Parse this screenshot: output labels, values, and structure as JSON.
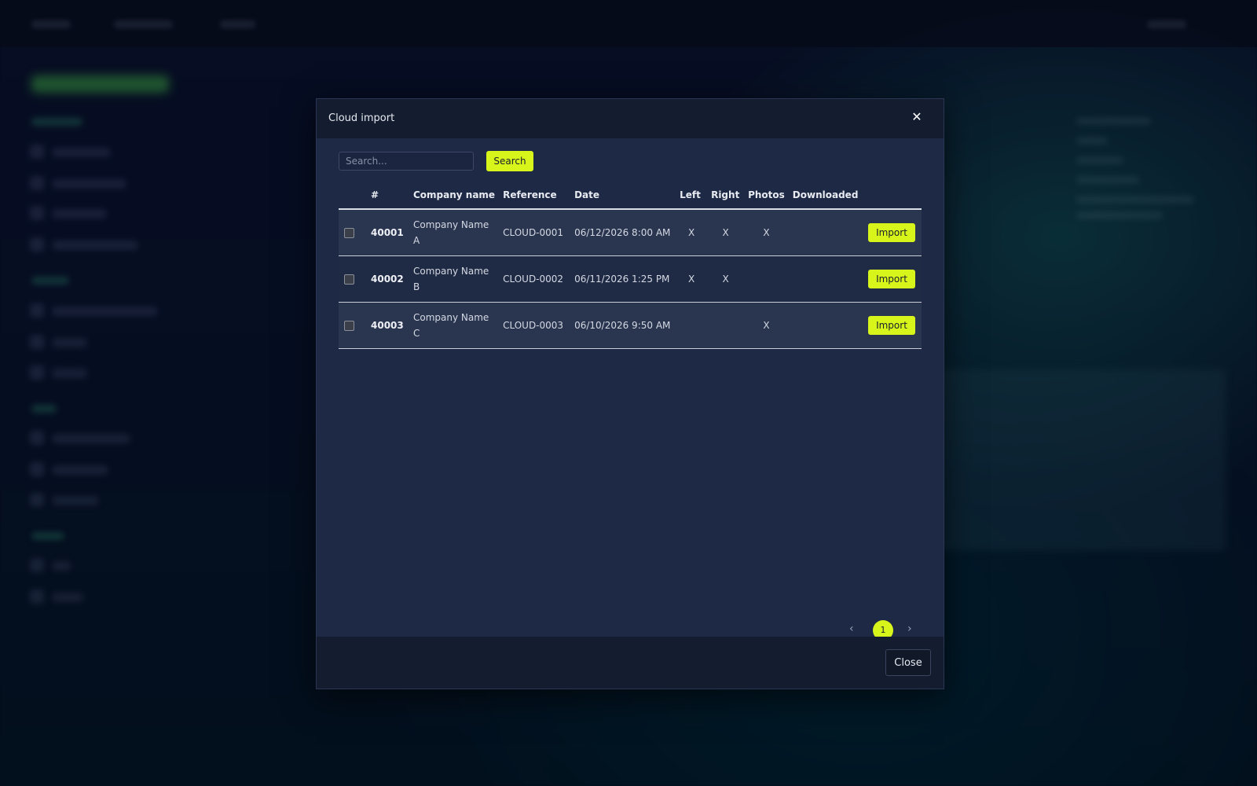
{
  "modal": {
    "title": "Cloud import",
    "close_icon": "close-icon",
    "search": {
      "placeholder": "Search...",
      "value": "",
      "button_label": "Search"
    },
    "table": {
      "headers": {
        "num": "#",
        "company": "Company name",
        "reference": "Reference",
        "date": "Date",
        "left": "Left",
        "right": "Right",
        "photos": "Photos",
        "downloaded": "Downloaded"
      },
      "rows": [
        {
          "id": "40001",
          "company": "Company Name A",
          "reference": "CLOUD-0001",
          "date": "06/12/2026 8:00 AM",
          "left": "X",
          "right": "X",
          "photos": "X",
          "downloaded": "",
          "action": "Import"
        },
        {
          "id": "40002",
          "company": "Company Name B",
          "reference": "CLOUD-0002",
          "date": "06/11/2026 1:25 PM",
          "left": "X",
          "right": "X",
          "photos": "",
          "downloaded": "",
          "action": "Import"
        },
        {
          "id": "40003",
          "company": "Company Name C",
          "reference": "CLOUD-0003",
          "date": "06/10/2026 9:50 AM",
          "left": "",
          "right": "",
          "photos": "X",
          "downloaded": "",
          "action": "Import"
        }
      ]
    },
    "pagination": {
      "prev": "‹",
      "current": "1",
      "next": "›"
    },
    "footer": {
      "close_label": "Close"
    }
  },
  "colors": {
    "accent": "#d7f51b",
    "modal_bg": "#1e2a45",
    "header_bg": "#141c2f"
  }
}
